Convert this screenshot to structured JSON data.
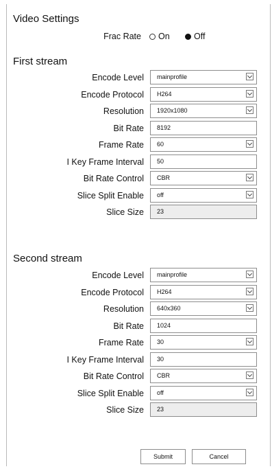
{
  "title": "Video Settings",
  "frac_rate": {
    "label": "Frac Rate",
    "options": [
      "On",
      "Off"
    ],
    "selected": "Off"
  },
  "first_stream": {
    "title": "First stream",
    "fields": [
      {
        "label": "Encode Level",
        "value": "mainprofile",
        "kind": "select"
      },
      {
        "label": "Encode Protocol",
        "value": "H264",
        "kind": "select"
      },
      {
        "label": "Resolution",
        "value": "1920x1080",
        "kind": "select"
      },
      {
        "label": "Bit Rate",
        "value": "8192",
        "kind": "input"
      },
      {
        "label": "Frame Rate",
        "value": "60",
        "kind": "select"
      },
      {
        "label": "I Key Frame Interval",
        "value": "50",
        "kind": "input"
      },
      {
        "label": "Bit Rate Control",
        "value": "CBR",
        "kind": "select"
      },
      {
        "label": "Slice Split Enable",
        "value": "off",
        "kind": "select"
      },
      {
        "label": "Slice Size",
        "value": "23",
        "kind": "readonly"
      }
    ]
  },
  "second_stream": {
    "title": "Second stream",
    "fields": [
      {
        "label": "Encode Level",
        "value": "mainprofile",
        "kind": "select"
      },
      {
        "label": "Encode Protocol",
        "value": "H264",
        "kind": "select"
      },
      {
        "label": "Resolution",
        "value": "640x360",
        "kind": "select"
      },
      {
        "label": "Bit Rate",
        "value": "1024",
        "kind": "input"
      },
      {
        "label": "Frame Rate",
        "value": "30",
        "kind": "select"
      },
      {
        "label": "I Key Frame Interval",
        "value": "30",
        "kind": "input"
      },
      {
        "label": "Bit Rate Control",
        "value": "CBR",
        "kind": "select"
      },
      {
        "label": "Slice Split Enable",
        "value": "off",
        "kind": "select"
      },
      {
        "label": "Slice Size",
        "value": "23",
        "kind": "readonly"
      }
    ]
  },
  "buttons": {
    "submit": "Submit",
    "cancel": "Cancel"
  }
}
